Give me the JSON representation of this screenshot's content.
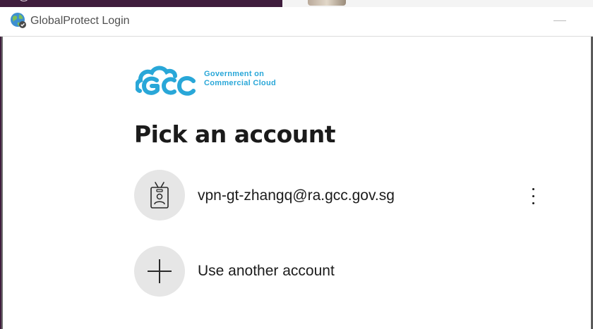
{
  "window": {
    "title": "GlobalProtect Login",
    "icon": "globe-icon"
  },
  "logo": {
    "line1": "Government on",
    "line2": "Commercial Cloud",
    "color": "#29a7d8"
  },
  "heading": "Pick an account",
  "accounts": [
    {
      "email": "vpn-gt-zhangq@ra.gcc.gov.sg",
      "icon": "badge-icon"
    }
  ],
  "add_account": {
    "label": "Use another account",
    "icon": "plus-icon"
  },
  "colors": {
    "text": "#1b1b1b",
    "circle_bg": "#e6e6e6",
    "background_app": "#3f1d3d"
  }
}
